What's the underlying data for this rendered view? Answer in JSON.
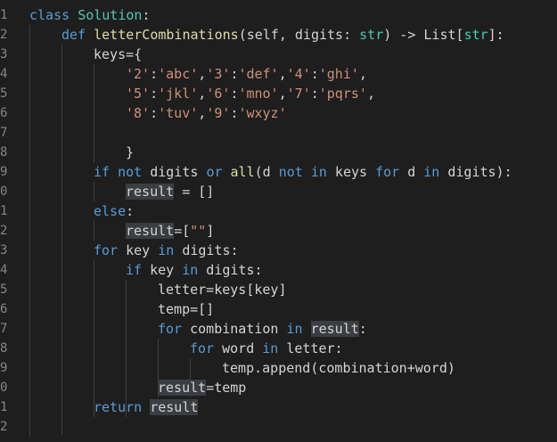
{
  "line_numbers": [
    "1",
    "2",
    "3",
    "4",
    "5",
    "6",
    "7",
    "8",
    "9",
    "0",
    "1",
    "2",
    "3",
    "4",
    "5",
    "6",
    "7",
    "8",
    "9",
    "0",
    "1",
    "2"
  ],
  "code": {
    "l1": {
      "a": "class",
      "b": " ",
      "c": "Solution",
      "d": ":"
    },
    "l2": {
      "a": "def",
      "b": " ",
      "c": "letterCombinations",
      "d": "(self, ",
      "e": "digits",
      "f": ": ",
      "g": "str",
      "h": ") -> List[",
      "i": "str",
      "j": "]:"
    },
    "l3": {
      "a": "keys={"
    },
    "l4": {
      "a": "'2'",
      "b": ":",
      "c": "'abc'",
      "d": ",",
      "e": "'3'",
      "f": ":",
      "g": "'def'",
      "h": ",",
      "i": "'4'",
      "j": ":",
      "k": "'ghi'",
      "l": ","
    },
    "l5": {
      "a": "'5'",
      "b": ":",
      "c": "'jkl'",
      "d": ",",
      "e": "'6'",
      "f": ":",
      "g": "'mno'",
      "h": ",",
      "i": "'7'",
      "j": ":",
      "k": "'pqrs'",
      "l": ","
    },
    "l6": {
      "a": "'8'",
      "b": ":",
      "c": "'tuv'",
      "d": ",",
      "e": "'9'",
      "f": ":",
      "g": "'wxyz'"
    },
    "l8": {
      "a": "}"
    },
    "l9": {
      "a": "if",
      "b": " ",
      "c": "not",
      "d": " digits ",
      "e": "or",
      "f": " ",
      "g": "all",
      "h": "(d ",
      "i": "not",
      "j": " ",
      "k": "in",
      "l": " keys ",
      "m": "for",
      "n": " d ",
      "o": "in",
      "p": " digits):"
    },
    "l10": {
      "a": "result",
      "b": " = []"
    },
    "l11": {
      "a": "else",
      "b": ":"
    },
    "l12": {
      "a": "result",
      "b": "=[",
      "c": "\"\"",
      "d": "]"
    },
    "l13": {
      "a": "for",
      "b": " key ",
      "c": "in",
      "d": " digits:"
    },
    "l14": {
      "a": "if",
      "b": " key ",
      "c": "in",
      "d": " digits:"
    },
    "l15": {
      "a": "letter=keys[key]"
    },
    "l16": {
      "a": "temp=[]"
    },
    "l17": {
      "a": "for",
      "b": " combination ",
      "c": "in",
      "d": " ",
      "e": "result",
      "f": ":"
    },
    "l18": {
      "a": "for",
      "b": " word ",
      "c": "in",
      "d": " letter:"
    },
    "l19": {
      "a": "temp.append(combination+word)"
    },
    "l20": {
      "a": "result",
      "b": "=temp"
    },
    "l21": {
      "a": "return",
      "b": " ",
      "c": "result"
    }
  },
  "colors": {
    "background": "#1e1e1e",
    "keyword": "#569cd6",
    "class_name": "#4ec9b0",
    "function": "#dcdcaa",
    "string": "#ce9178",
    "text": "#d4d4d4",
    "line_number": "#858585",
    "highlight": "#3a3d41"
  }
}
